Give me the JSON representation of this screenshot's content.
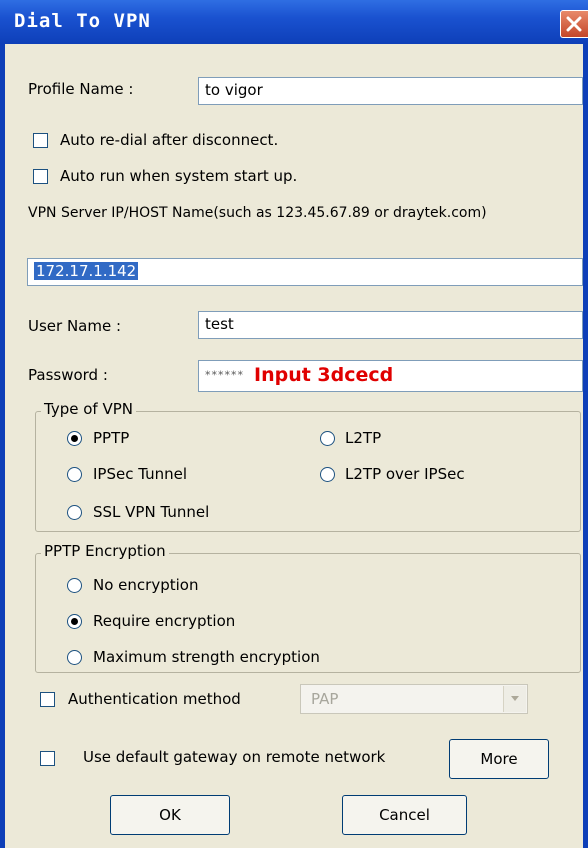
{
  "window": {
    "title": "Dial To VPN"
  },
  "profile": {
    "label": "Profile Name :",
    "value": "to vigor"
  },
  "options": {
    "auto_redial_label": "Auto re-dial after disconnect.",
    "auto_run_label": "Auto run when system start up."
  },
  "server": {
    "label": "VPN Server IP/HOST Name(such as 123.45.67.89 or draytek.com)",
    "value": "172.17.1.142"
  },
  "user": {
    "label": "User Name :",
    "value": "test"
  },
  "password": {
    "label": "Password :",
    "mask": "******",
    "note": "Input 3dcecd"
  },
  "vpn_type": {
    "title": "Type of VPN",
    "pptp": "PPTP",
    "l2tp": "L2TP",
    "ipsec_tunnel": "IPSec Tunnel",
    "l2tp_over_ipsec": "L2TP over IPSec",
    "ssl_vpn_tunnel": "SSL VPN Tunnel",
    "selected": "PPTP"
  },
  "encryption": {
    "title": "PPTP Encryption",
    "none": "No encryption",
    "require": "Require encryption",
    "maximum": "Maximum strength encryption",
    "selected": "Require encryption"
  },
  "auth": {
    "label": "Authentication method",
    "value": "PAP"
  },
  "gateway": {
    "label": "Use default gateway on remote network"
  },
  "buttons": {
    "more": "More",
    "ok": "OK",
    "cancel": "Cancel"
  },
  "colors": {
    "title_bar": "#1a52d0",
    "face": "#ece9d8",
    "selection": "#316ac5",
    "note": "#e00000"
  }
}
